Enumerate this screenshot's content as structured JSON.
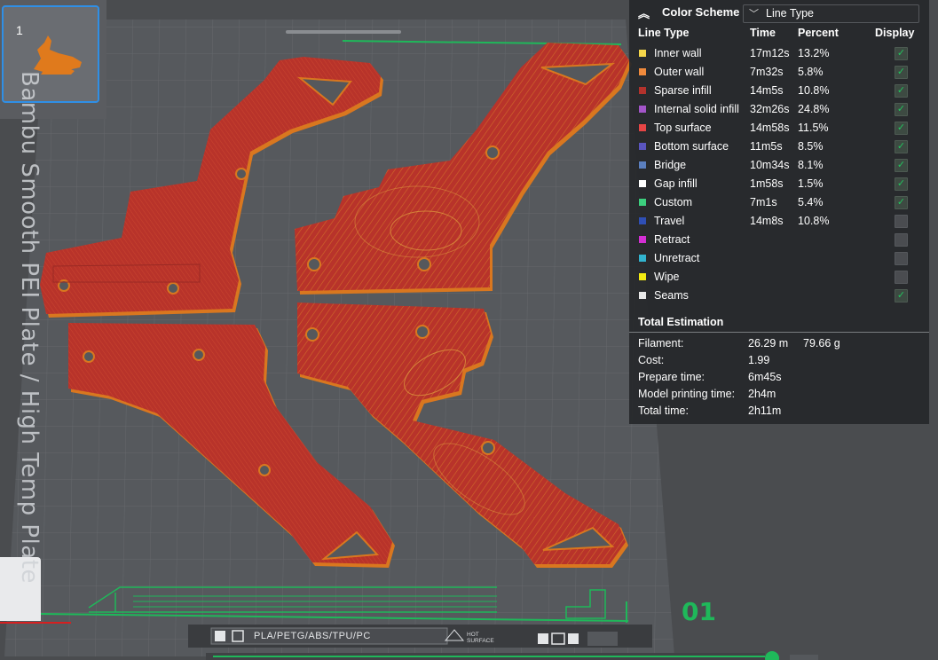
{
  "plate": {
    "number": "1",
    "name": "Bambu Smooth PEI Plate / High Temp Plate",
    "index_label": "01",
    "filament_types": "PLA/PETG/ABS/TPU/PC",
    "hot_surface_line1": "HOT",
    "hot_surface_line2": "SURFACE"
  },
  "color_scheme": {
    "title": "Color Scheme",
    "selected": "Line Type"
  },
  "table_headers": {
    "line_type": "Line Type",
    "time": "Time",
    "percent": "Percent",
    "display": "Display"
  },
  "line_types": [
    {
      "name": "Inner wall",
      "time": "17m12s",
      "percent": "13.2%",
      "color": "#f5d64a",
      "display": true
    },
    {
      "name": "Outer wall",
      "time": "7m32s",
      "percent": "5.8%",
      "color": "#f08a3c",
      "display": true
    },
    {
      "name": "Sparse infill",
      "time": "14m5s",
      "percent": "10.8%",
      "color": "#b3322c",
      "display": true
    },
    {
      "name": "Internal solid infill",
      "time": "32m26s",
      "percent": "24.8%",
      "color": "#a355c9",
      "display": true
    },
    {
      "name": "Top surface",
      "time": "14m58s",
      "percent": "11.5%",
      "color": "#e64545",
      "display": true
    },
    {
      "name": "Bottom surface",
      "time": "11m5s",
      "percent": "8.5%",
      "color": "#5a55c0",
      "display": true
    },
    {
      "name": "Bridge",
      "time": "10m34s",
      "percent": "8.1%",
      "color": "#5b7fbf",
      "display": true
    },
    {
      "name": "Gap infill",
      "time": "1m58s",
      "percent": "1.5%",
      "color": "#ffffff",
      "display": true
    },
    {
      "name": "Custom",
      "time": "7m1s",
      "percent": "5.4%",
      "color": "#3ccf7e",
      "display": true
    },
    {
      "name": "Travel",
      "time": "14m8s",
      "percent": "10.8%",
      "color": "#2f4fb5",
      "display": false
    },
    {
      "name": "Retract",
      "time": "",
      "percent": "",
      "color": "#d42fd4",
      "display": false
    },
    {
      "name": "Unretract",
      "time": "",
      "percent": "",
      "color": "#32b4cf",
      "display": false
    },
    {
      "name": "Wipe",
      "time": "",
      "percent": "",
      "color": "#f2ea12",
      "display": false
    },
    {
      "name": "Seams",
      "time": "",
      "percent": "",
      "color": "#e8e8e8",
      "display": true
    }
  ],
  "total_estimation": {
    "title": "Total Estimation",
    "rows": [
      {
        "label": "Filament:",
        "value": "26.29 m",
        "value2": "79.66 g"
      },
      {
        "label": "Cost:",
        "value": "1.99",
        "value2": ""
      },
      {
        "label": "Prepare time:",
        "value": "6m45s",
        "value2": ""
      },
      {
        "label": "Model printing time:",
        "value": "2h4m",
        "value2": ""
      },
      {
        "label": "Total time:",
        "value": "2h11m",
        "value2": ""
      }
    ]
  },
  "colors": {
    "part_fill": "#b8332a",
    "part_edge": "#d9771f",
    "bed": "#5b5e62",
    "grid": "#6a6d71",
    "accent_green": "#1fb85a"
  }
}
